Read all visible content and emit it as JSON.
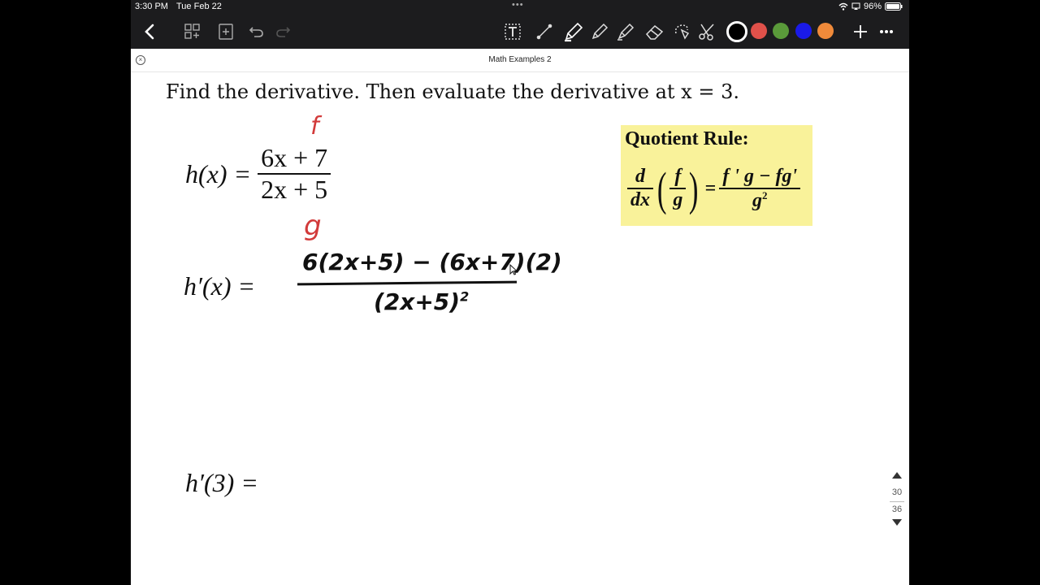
{
  "status": {
    "time": "3:30 PM",
    "date": "Tue Feb 22",
    "battery": "96%"
  },
  "document": {
    "title": "Math Examples 2"
  },
  "toolbar": {
    "icons": [
      "back-chevron-icon",
      "page-grid-icon",
      "add-page-icon",
      "undo-icon",
      "redo-icon",
      "text-tool-icon",
      "line-tool-icon",
      "pen-icon",
      "pencil-icon",
      "highlighter-icon",
      "eraser-icon",
      "lasso-icon",
      "scissors-icon",
      "add-icon",
      "more-icon"
    ],
    "colors": [
      "#000000",
      "#e0514a",
      "#5a9a3a",
      "#1a1ae8",
      "#f08a3a"
    ]
  },
  "content": {
    "prompt": "Find the derivative.  Then evaluate the derivative at x = 3.",
    "h_lhs": "h(x) =",
    "h_num": "6x + 7",
    "h_den": "2x + 5",
    "f_label": "f",
    "g_label": "g",
    "hp_lhs": "h′(x) =",
    "hp_num": "6(2x+5) − (6x+7)(2)",
    "hp_den": "(2x+5)",
    "hp_exp": "2",
    "h3_lhs": "h′(3) ="
  },
  "quotient_rule": {
    "title": "Quotient Rule:",
    "d": "d",
    "dx": "dx",
    "f": "f",
    "g": "g",
    "rhs_num": "f ' g − fg'",
    "rhs_den": "g",
    "rhs_exp": "2",
    "eq": "="
  },
  "pager": {
    "current": "30",
    "total": "36"
  }
}
